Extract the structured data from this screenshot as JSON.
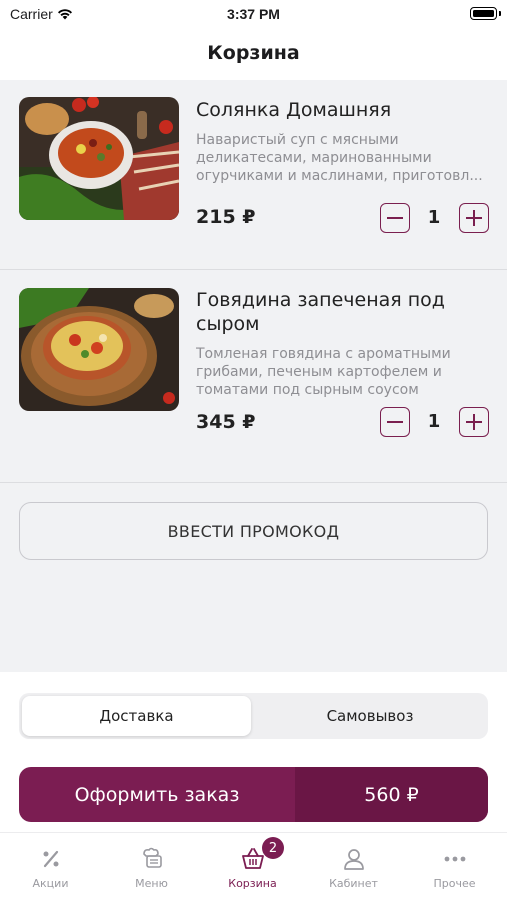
{
  "status_bar": {
    "carrier": "Carrier",
    "time": "3:37 PM"
  },
  "header": {
    "title": "Корзина"
  },
  "cart": {
    "items": [
      {
        "name": "Солянка Домашняя",
        "description": "Наваристый суп с мясными деликатесами, маринованными огурчиками и маслинами, приготовл...",
        "price": "215 ₽",
        "quantity": "1"
      },
      {
        "name": "Говядина запеченая под сыром",
        "description": "Томленая говядина с ароматными грибами, печеным картофелем и томатами под сырным соусом",
        "price": "345 ₽",
        "quantity": "1"
      }
    ],
    "promo_label": "ВВЕСТИ ПРОМОКОД"
  },
  "delivery": {
    "options": [
      "Доставка",
      "Самовывоз"
    ],
    "selected": "Доставка"
  },
  "checkout": {
    "label": "Оформить заказ",
    "total": "560 ₽"
  },
  "tab_bar": {
    "tabs": [
      {
        "label": "Акции",
        "icon": "percent-icon"
      },
      {
        "label": "Меню",
        "icon": "chef-menu-icon"
      },
      {
        "label": "Корзина",
        "icon": "basket-icon",
        "badge": "2",
        "active": true
      },
      {
        "label": "Кабинет",
        "icon": "person-icon"
      },
      {
        "label": "Прочее",
        "icon": "more-dots-icon"
      }
    ]
  },
  "colors": {
    "accent": "#7b1d52",
    "accent_dark": "#6a1645",
    "background": "#f1f2f4",
    "muted_text": "#8e8e93"
  }
}
